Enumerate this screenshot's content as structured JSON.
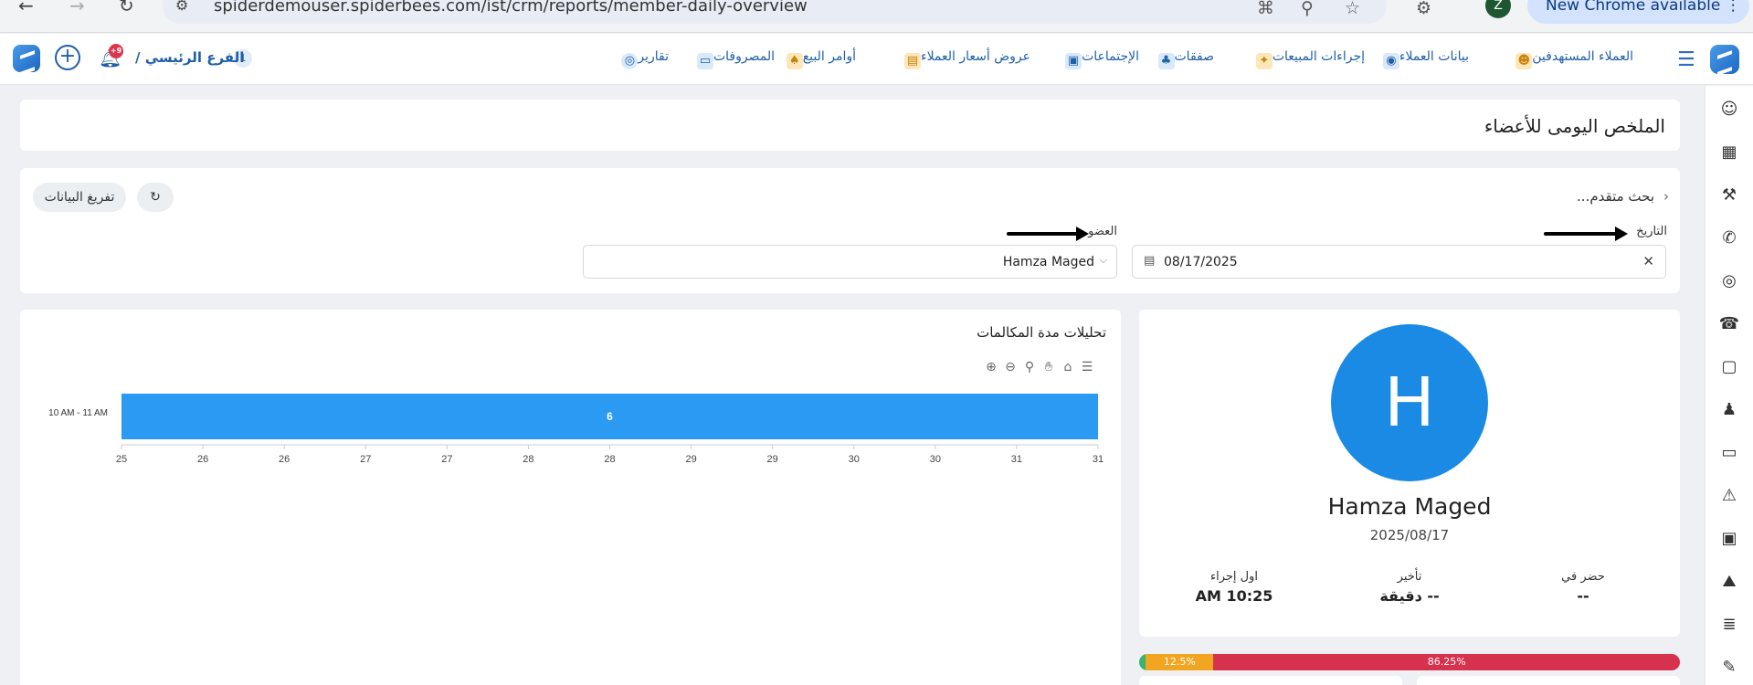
{
  "browser": {
    "url": "spiderdemouser.spiderbees.com/ist/crm/reports/member-daily-overview",
    "profile_initial": "Z",
    "update_label": "New Chrome available"
  },
  "header": {
    "branch_label": "الفرع الرئيسي /",
    "branch_count": "1",
    "notification_count": "+9",
    "nav": [
      {
        "label": "العملاء المستهدفين",
        "icon": "target-customers-icon",
        "color": "#f2b33d"
      },
      {
        "label": "بيانات العملاء",
        "icon": "customer-data-icon",
        "color": "#3b8fd9"
      },
      {
        "label": "إجراءات المبيعات",
        "icon": "sales-actions-icon",
        "color": "#f2b33d"
      },
      {
        "label": "صفقات",
        "icon": "deals-icon",
        "color": "#3b8fd9"
      },
      {
        "label": "الإجتماعات",
        "icon": "meetings-icon",
        "color": "#3b8fd9"
      },
      {
        "label": "عروض أسعار العملاء",
        "icon": "quotes-icon",
        "color": "#e8a62c"
      },
      {
        "label": "أوامر البيع",
        "icon": "sales-orders-icon",
        "color": "#f2b33d"
      },
      {
        "label": "المصروفات",
        "icon": "expenses-icon",
        "color": "#3b8fd9"
      },
      {
        "label": "تقارير",
        "icon": "reports-icon",
        "color": "#3b8fd9"
      }
    ]
  },
  "page": {
    "title": "الملخص اليومى للأعضاء"
  },
  "filters": {
    "advanced_search": "بحث متقدم...",
    "date_label": "التاريخ",
    "date_value": "08/17/2025",
    "member_label": "العضو",
    "member_value": "Hamza Maged",
    "clear_label": "تفريغ البيانات"
  },
  "chart_title": "تحليلات مدة المكالمات",
  "chart_data": {
    "type": "bar",
    "orientation": "horizontal",
    "categories": [
      "10 AM - 11 AM"
    ],
    "values": [
      6
    ],
    "data_labels": [
      "6"
    ],
    "x_ticks": [
      "25",
      "26",
      "26",
      "27",
      "27",
      "28",
      "28",
      "29",
      "29",
      "30",
      "30",
      "31",
      "31"
    ],
    "color": "#2b9af3",
    "grid": false,
    "toolbar": [
      "zoom-in-icon",
      "zoom-out-icon",
      "magnify-icon",
      "pan-icon",
      "home-icon",
      "menu-icon"
    ]
  },
  "profile": {
    "initial": "H",
    "name": "Hamza Maged",
    "date": "2025/08/17",
    "stats": {
      "attended_label": "حضر في",
      "attended_value": "--",
      "delay_label": "تأخير",
      "delay_value": "-- دقيقة",
      "first_action_label": "اول إجراء",
      "first_action_value": "AM 10:25"
    }
  },
  "progress": [
    {
      "label": "86.25%",
      "value": 86.25,
      "color": "#d7324d"
    },
    {
      "label": "12.5%",
      "value": 12.5,
      "color": "#f2a521"
    },
    {
      "label": "",
      "value": 1.25,
      "color": "#3cb371"
    }
  ],
  "sidebar_icons": [
    "contacts-icon",
    "building-icon",
    "stamp-icon",
    "phone-call-icon",
    "target-icon",
    "telephone-icon",
    "calendar-add-icon",
    "team-icon",
    "cash-icon",
    "warning-icon",
    "video-call-icon",
    "mountain-icon",
    "invoice-icon",
    "pen-icon"
  ]
}
